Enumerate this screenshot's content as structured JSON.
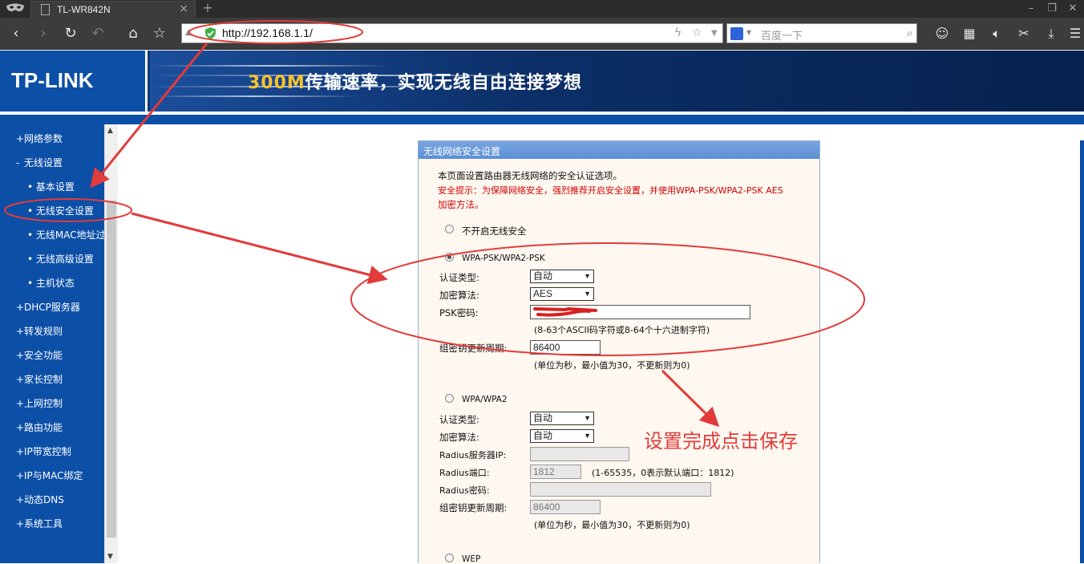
{
  "browser": {
    "tab_title": "TL-WR842N",
    "tab_close": "×",
    "new_tab": "+",
    "url": "http://192.168.1.1/",
    "search_placeholder": "百度一下"
  },
  "banner": {
    "logo": "TP-LINK",
    "slogan_highlight": "300M",
    "slogan_rest": "传输速率，实现无线自由连接梦想"
  },
  "sidebar": {
    "items": [
      {
        "marker": "+",
        "label": "网络参数"
      },
      {
        "marker": "-",
        "label": "无线设置"
      },
      {
        "marker": "•",
        "label": "基本设置"
      },
      {
        "marker": "•",
        "label": "无线安全设置"
      },
      {
        "marker": "•",
        "label": "无线MAC地址过滤"
      },
      {
        "marker": "•",
        "label": "无线高级设置"
      },
      {
        "marker": "•",
        "label": "主机状态"
      },
      {
        "marker": "+",
        "label": "DHCP服务器"
      },
      {
        "marker": "+",
        "label": "转发规则"
      },
      {
        "marker": "+",
        "label": "安全功能"
      },
      {
        "marker": "+",
        "label": "家长控制"
      },
      {
        "marker": "+",
        "label": "上网控制"
      },
      {
        "marker": "+",
        "label": "路由功能"
      },
      {
        "marker": "+",
        "label": "IP带宽控制"
      },
      {
        "marker": "+",
        "label": "IP与MAC绑定"
      },
      {
        "marker": "+",
        "label": "动态DNS"
      },
      {
        "marker": "+",
        "label": "系统工具"
      }
    ],
    "selected": "无线安全设置"
  },
  "panel": {
    "title": "无线网络安全设置",
    "intro": "本页面设置路由器无线网络的安全认证选项。",
    "warning_line1": "安全提示：为保障网络安全，强烈推荐开启安全设置，并使用WPA-PSK/WPA2-PSK AES",
    "warning_line2": "加密方法。",
    "opt_none": "不开启无线安全",
    "selected_mode": "WPA-PSK/WPA2-PSK",
    "wpa_psk": {
      "label": "WPA-PSK/WPA2-PSK",
      "auth_label": "认证类型:",
      "auth_value": "自动",
      "enc_label": "加密算法:",
      "enc_value": "AES",
      "psk_label": "PSK密码:",
      "psk_hint": "(8-63个ASCII码字符或8-64个十六进制字符)",
      "renew_label": "组密钥更新周期:",
      "renew_value": "86400",
      "renew_hint": "(单位为秒，最小值为30，不更新则为0)"
    },
    "wpa": {
      "label": "WPA/WPA2",
      "auth_label": "认证类型:",
      "auth_value": "自动",
      "enc_label": "加密算法:",
      "enc_value": "自动",
      "radius_ip_label": "Radius服务器IP:",
      "radius_port_label": "Radius端口:",
      "radius_port_value": "1812",
      "radius_port_hint": "(1-65535，0表示默认端口：1812)",
      "radius_pw_label": "Radius密码:",
      "renew_label": "组密钥更新周期:",
      "renew_value": "86400",
      "renew_hint": "(单位为秒，最小值为30，不更新则为0)"
    },
    "wep_label": "WEP"
  },
  "annotation": {
    "text": "设置完成点击保存",
    "color": "#e23b3b"
  }
}
